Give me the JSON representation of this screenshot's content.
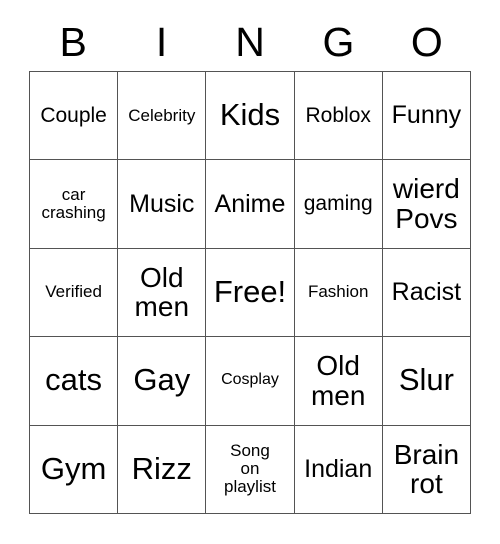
{
  "card": {
    "headers": [
      "B",
      "I",
      "N",
      "G",
      "O"
    ],
    "rows": [
      [
        {
          "text": "Couple",
          "size": "s-sm"
        },
        {
          "text": "Celebrity",
          "size": "s-xs"
        },
        {
          "text": "Kids",
          "size": "s-xl"
        },
        {
          "text": "Roblox",
          "size": "s-sm"
        },
        {
          "text": "Funny",
          "size": "s-md"
        }
      ],
      [
        {
          "text": "car\ncrashing",
          "size": "s-xs"
        },
        {
          "text": "Music",
          "size": "s-md"
        },
        {
          "text": "Anime",
          "size": "s-md"
        },
        {
          "text": "gaming",
          "size": "s-sm"
        },
        {
          "text": "wierd\nPovs",
          "size": "s-lg"
        }
      ],
      [
        {
          "text": "Verified",
          "size": "s-xs"
        },
        {
          "text": "Old\nmen",
          "size": "s-lg"
        },
        {
          "text": "Free!",
          "size": "s-xl"
        },
        {
          "text": "Fashion",
          "size": "s-xs"
        },
        {
          "text": "Racist",
          "size": "s-md"
        }
      ],
      [
        {
          "text": "cats",
          "size": "s-xl"
        },
        {
          "text": "Gay",
          "size": "s-xl"
        },
        {
          "text": "Cosplay",
          "size": "s-xxs"
        },
        {
          "text": "Old\nmen",
          "size": "s-lg"
        },
        {
          "text": "Slur",
          "size": "s-xl"
        }
      ],
      [
        {
          "text": "Gym",
          "size": "s-xl"
        },
        {
          "text": "Rizz",
          "size": "s-xl"
        },
        {
          "text": "Song\non\nplaylist",
          "size": "s-xs"
        },
        {
          "text": "Indian",
          "size": "s-md"
        },
        {
          "text": "Brain\nrot",
          "size": "s-lg"
        }
      ]
    ]
  },
  "colors": {
    "grid_line": "#545454",
    "text": "#000000",
    "background": "#ffffff"
  }
}
